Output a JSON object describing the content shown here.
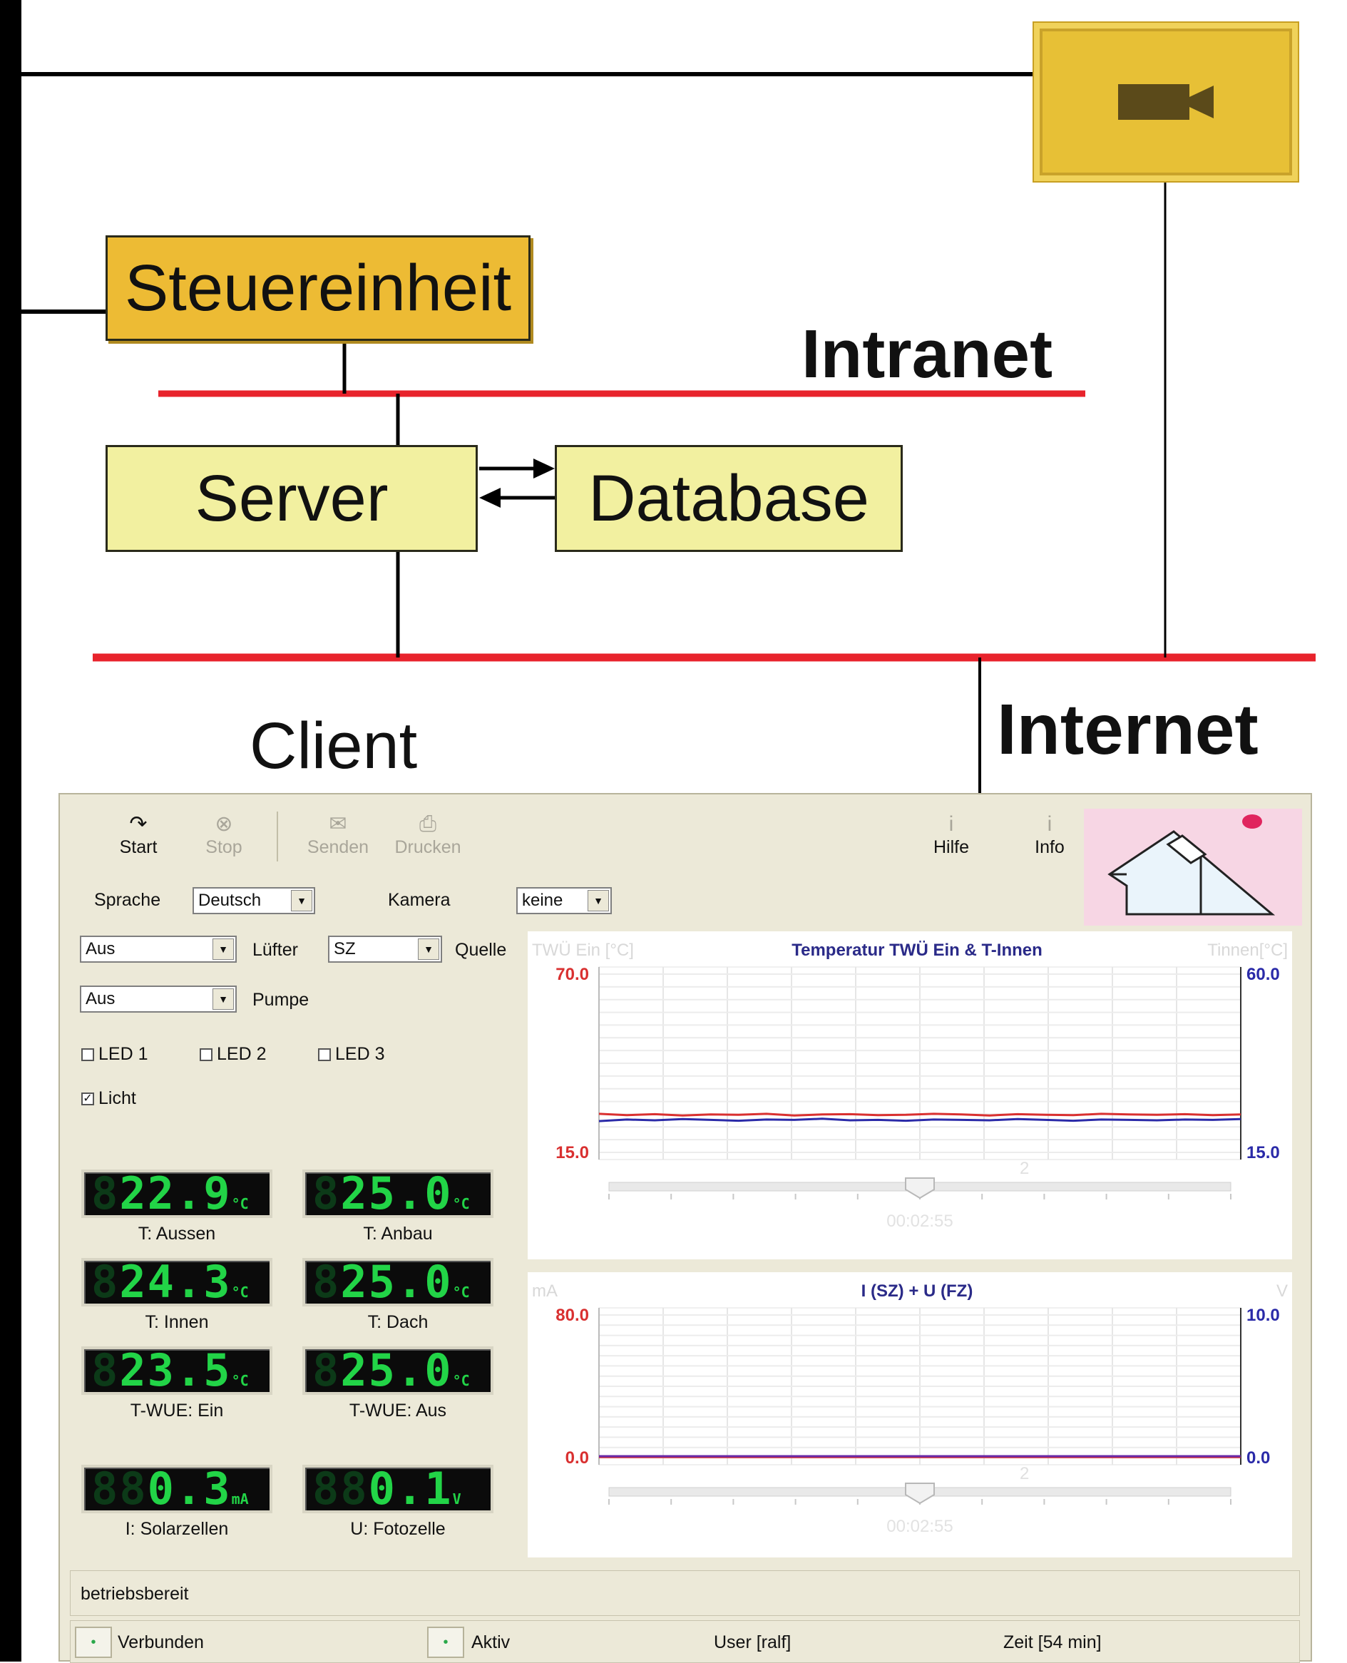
{
  "diagram": {
    "steuereinheit": "Steuereinheit",
    "server": "Server",
    "database": "Database",
    "intranet": "Intranet",
    "internet": "Internet",
    "client": "Client"
  },
  "toolbar": {
    "start": "Start",
    "stop": "Stop",
    "senden": "Senden",
    "drucken": "Drucken",
    "hilfe": "Hilfe",
    "info": "Info"
  },
  "controls": {
    "sprache_label": "Sprache",
    "sprache_value": "Deutsch",
    "kamera_label": "Kamera",
    "kamera_value": "keine",
    "luefter_value": "Aus",
    "luefter_label": "Lüfter",
    "quelle_value": "SZ",
    "quelle_label": "Quelle",
    "pumpe_value": "Aus",
    "pumpe_label": "Pumpe",
    "led1": "LED 1",
    "led2": "LED 2",
    "led3": "LED 3",
    "licht": "Licht",
    "licht_checked": true
  },
  "displays": [
    {
      "ghost": "8",
      "value": "22.9",
      "unit": "°C",
      "label": "T: Aussen"
    },
    {
      "ghost": "8",
      "value": "25.0",
      "unit": "°C",
      "label": "T: Anbau"
    },
    {
      "ghost": "8",
      "value": "24.3",
      "unit": "°C",
      "label": "T: Innen"
    },
    {
      "ghost": "8",
      "value": "25.0",
      "unit": "°C",
      "label": "T: Dach"
    },
    {
      "ghost": "8",
      "value": "23.5",
      "unit": "°C",
      "label": "T-WUE: Ein"
    },
    {
      "ghost": "8",
      "value": "25.0",
      "unit": "°C",
      "label": "T-WUE: Aus"
    },
    {
      "ghost": "88",
      "value": "0.3",
      "unit": "mA",
      "label": "I: Solarzellen"
    },
    {
      "ghost": "88",
      "value": "0.1",
      "unit": "V",
      "label": "U: Fotozelle"
    }
  ],
  "chart_data": [
    {
      "type": "line",
      "title": "Temperatur TWÜ Ein & T-Innen",
      "ylabel_left": "TWÜ Ein [°C]",
      "ylabel_right": "Tinnen[°C]",
      "ylim_left": [
        15.0,
        70.0
      ],
      "ylim_right": [
        15.0,
        60.0
      ],
      "left_ticks": [
        "70.0",
        "15.0"
      ],
      "right_ticks": [
        "60.0",
        "15.0"
      ],
      "marker": "2",
      "time": "00:02:55",
      "left_color": "#d93030",
      "right_color": "#2a2aa8",
      "series": [
        {
          "axis": "left",
          "color": "#d93030",
          "values": [
            26.9,
            26.5,
            26.8,
            26.4,
            26.7,
            26.6,
            26.9,
            26.4,
            26.7,
            26.8,
            26.5,
            26.6,
            26.9,
            26.7,
            26.4,
            26.8,
            26.6,
            26.5,
            26.9,
            26.7,
            26.6,
            26.8,
            26.5,
            26.7
          ]
        },
        {
          "axis": "right",
          "color": "#2a2aa8",
          "values": [
            22.9,
            23.3,
            23.1,
            23.4,
            23.2,
            23.0,
            23.3,
            23.2,
            23.5,
            23.1,
            23.2,
            23.0,
            23.3,
            23.2,
            23.1,
            23.4,
            23.2,
            23.0,
            23.3,
            23.2,
            23.1,
            23.3,
            23.2,
            23.4
          ]
        }
      ]
    },
    {
      "type": "line",
      "title": "I (SZ) + U (FZ)",
      "ylabel_left": "mA",
      "ylabel_right": "V",
      "ylim_left": [
        0.0,
        80.0
      ],
      "ylim_right": [
        0.0,
        10.0
      ],
      "left_ticks": [
        "80.0",
        "0.0"
      ],
      "right_ticks": [
        "10.0",
        "0.0"
      ],
      "marker": "2",
      "time": "00:02:55",
      "left_color": "#d93030",
      "right_color": "#2a2aa8",
      "series": [
        {
          "axis": "left",
          "color": "#d93030",
          "values": [
            0.3,
            0.3,
            0.3,
            0.3,
            0.3,
            0.3,
            0.3,
            0.3,
            0.3,
            0.3,
            0.3,
            0.3
          ]
        },
        {
          "axis": "right",
          "color": "#6a2aa8",
          "values": [
            0.1,
            0.1,
            0.1,
            0.1,
            0.1,
            0.1,
            0.1,
            0.1,
            0.1,
            0.1,
            0.1,
            0.1
          ]
        }
      ]
    }
  ],
  "status": {
    "message": "betriebsbereit",
    "verbunden": "Verbunden",
    "aktiv": "Aktiv",
    "user": "User [ralf]",
    "zeit": "Zeit [54 min]"
  }
}
